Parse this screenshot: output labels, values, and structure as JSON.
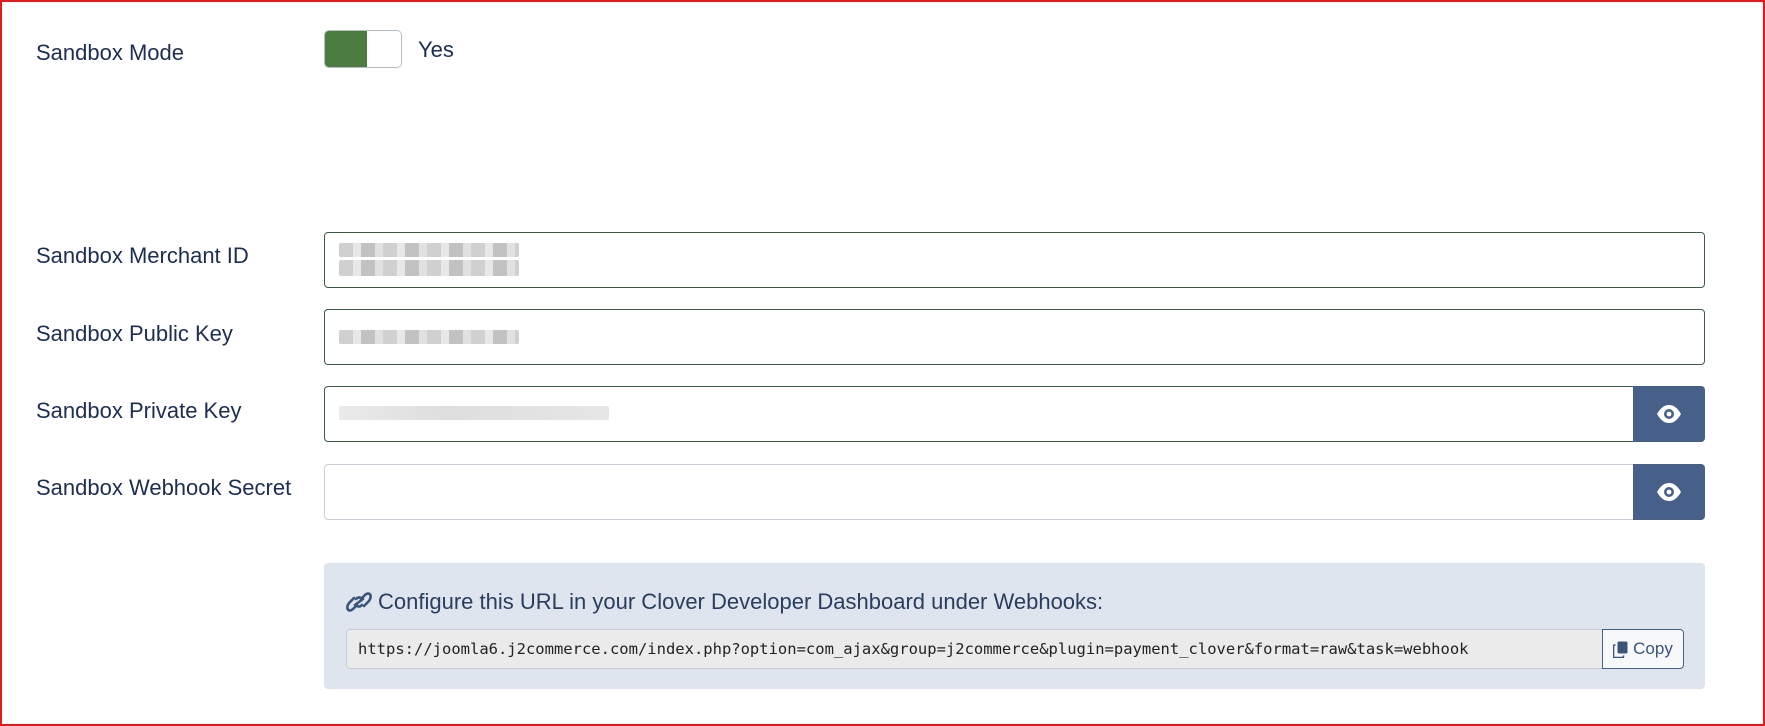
{
  "sandbox_mode": {
    "label": "Sandbox Mode",
    "value_text": "Yes",
    "enabled": true,
    "on_color": "#4a7d3e"
  },
  "fields": {
    "merchant_id": {
      "label": "Sandbox Merchant ID"
    },
    "public_key": {
      "label": "Sandbox Public Key"
    },
    "private_key": {
      "label": "Sandbox Private Key",
      "toggle_icon": "eye-icon"
    },
    "webhook_secret": {
      "label": "Sandbox Webhook Secret",
      "toggle_icon": "eye-icon"
    }
  },
  "webhook_info": {
    "icon": "link-icon",
    "text": "Configure this URL in your Clover Developer Dashboard under Webhooks:",
    "url": "https://joomla6.j2commerce.com/index.php?option=com_ajax&group=j2commerce&plugin=payment_clover&format=raw&task=webhook",
    "copy_label": "Copy",
    "copy_icon": "copy-icon"
  },
  "colors": {
    "button": "#466089",
    "info_bg": "#dfe5ee",
    "frame": "#e21a1a"
  }
}
